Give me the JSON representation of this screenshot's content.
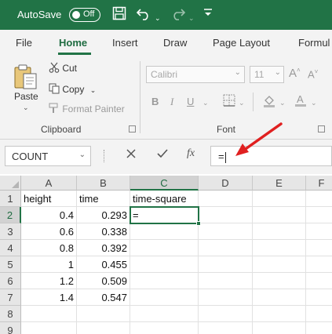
{
  "titlebar": {
    "autosave_label": "AutoSave",
    "toggle_state": "Off"
  },
  "tabs": [
    "File",
    "Home",
    "Insert",
    "Draw",
    "Page Layout",
    "Formul"
  ],
  "active_tab": "Home",
  "ribbon": {
    "clipboard": {
      "paste": "Paste",
      "cut": "Cut",
      "copy": "Copy",
      "format_painter": "Format Painter",
      "group_label": "Clipboard"
    },
    "font": {
      "font_name": "Calibri",
      "font_size": "11",
      "group_label": "Font"
    }
  },
  "formula_bar": {
    "name_box": "COUNT",
    "fx_label": "fx",
    "formula": "="
  },
  "grid": {
    "columns": [
      "A",
      "B",
      "C",
      "D",
      "E",
      "F"
    ],
    "rows": [
      "1",
      "2",
      "3",
      "4",
      "5",
      "6",
      "7",
      "8",
      "9"
    ],
    "cells": [
      [
        "height",
        "time",
        "time-square"
      ],
      [
        "0.4",
        "0.293",
        "="
      ],
      [
        "0.6",
        "0.338",
        ""
      ],
      [
        "0.8",
        "0.392",
        ""
      ],
      [
        "1",
        "0.455",
        ""
      ],
      [
        "1.2",
        "0.509",
        ""
      ],
      [
        "1.4",
        "0.547",
        ""
      ],
      [
        "",
        "",
        ""
      ],
      [
        "",
        "",
        ""
      ]
    ],
    "active_cell": "C2"
  },
  "colors": {
    "excel_green": "#217346",
    "annotation_arrow": "#e02020"
  }
}
